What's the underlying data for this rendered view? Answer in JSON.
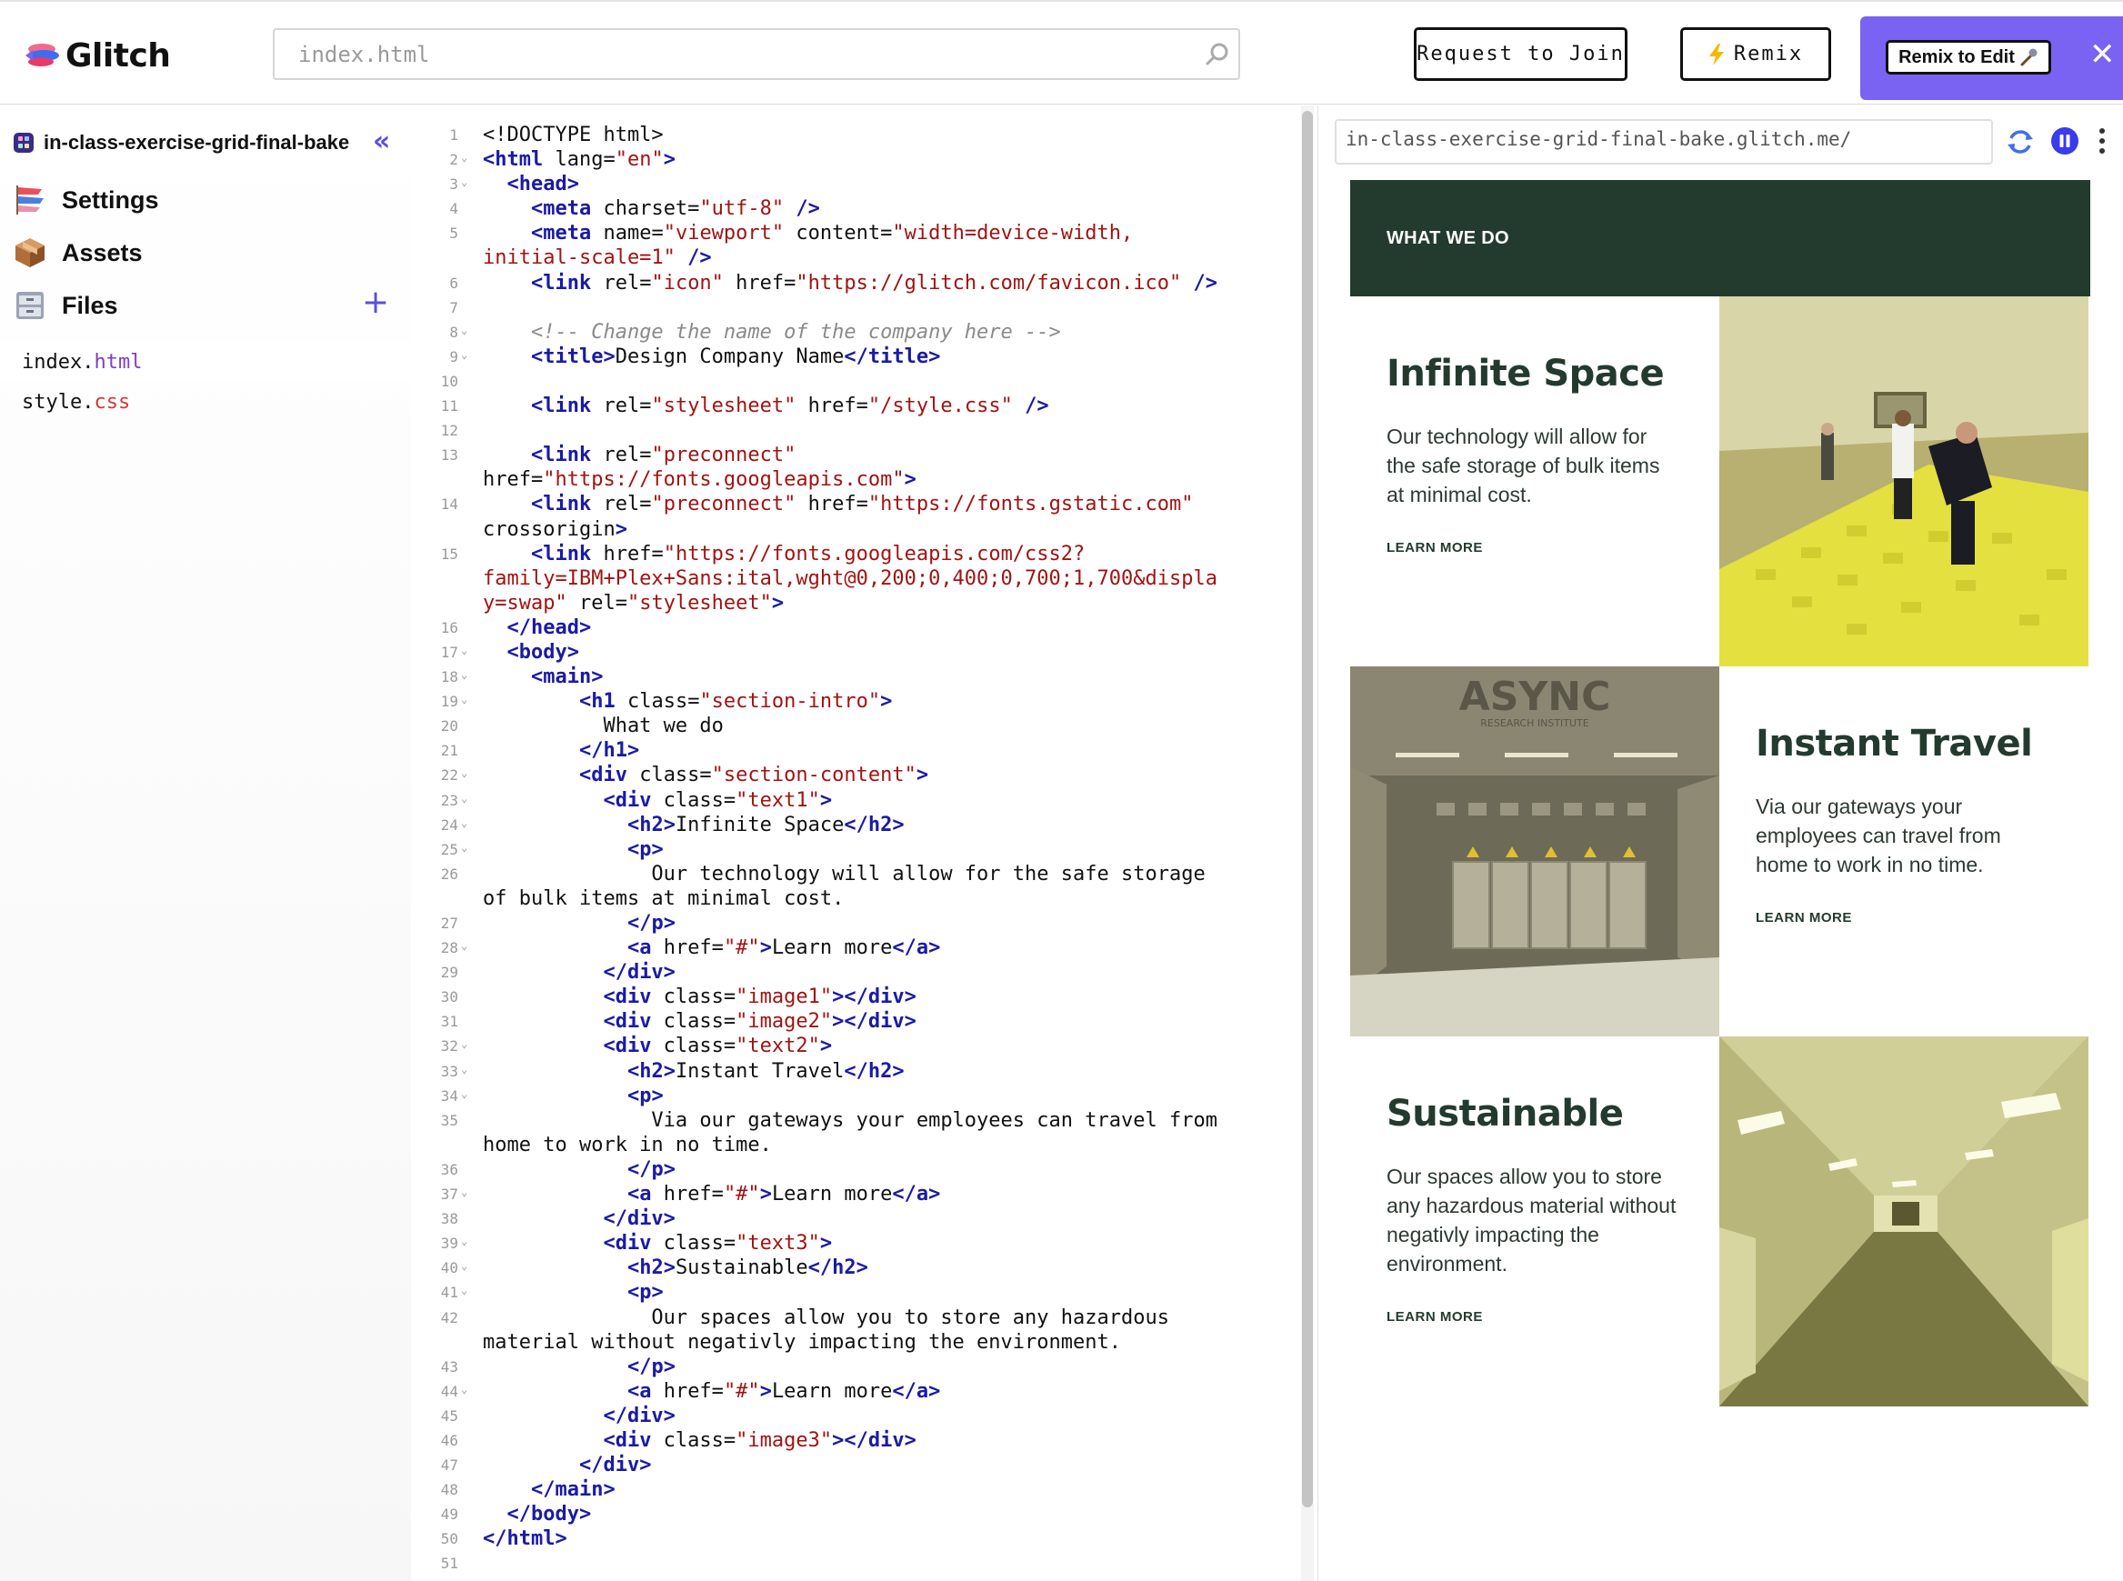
{
  "header": {
    "app_name": "Glitch",
    "search_placeholder": "index.html",
    "request_join_label": "Request to Join",
    "remix_label": "Remix",
    "remix_to_edit_label": "Remix to Edit",
    "close_symbol": "✕"
  },
  "sidebar": {
    "project_name": "in-class-exercise-grid-final-bake",
    "collapse_symbol": "«",
    "nav": [
      {
        "label": "Settings",
        "icon": "settings-carp-icon"
      },
      {
        "label": "Assets",
        "icon": "package-icon"
      },
      {
        "label": "Files",
        "icon": "file-cabinet-icon"
      }
    ],
    "add_symbol": "+",
    "files": [
      {
        "base": "index.",
        "ext": "html"
      },
      {
        "base": "style.",
        "ext": "css"
      }
    ]
  },
  "editor": {
    "lines": [
      [
        [
          "a",
          "<!DOCTYPE html>"
        ]
      ],
      [
        [
          "t",
          "<html"
        ],
        [
          "a",
          " lang="
        ],
        [
          "s",
          "\"en\""
        ],
        [
          "t",
          ">"
        ]
      ],
      [
        [
          "a",
          "  "
        ],
        [
          "t",
          "<head>"
        ]
      ],
      [
        [
          "a",
          "    "
        ],
        [
          "t",
          "<meta"
        ],
        [
          "a",
          " charset="
        ],
        [
          "s",
          "\"utf-8\""
        ],
        [
          "a",
          " "
        ],
        [
          "t",
          "/>"
        ]
      ],
      [
        [
          "a",
          "    "
        ],
        [
          "t",
          "<meta"
        ],
        [
          "a",
          " name="
        ],
        [
          "s",
          "\"viewport\""
        ],
        [
          "a",
          " content="
        ],
        [
          "s",
          "\"width=device-width,"
        ]
      ],
      [
        [
          "s",
          "initial-scale=1\""
        ],
        [
          "a",
          " "
        ],
        [
          "t",
          "/>"
        ]
      ],
      [
        [
          "a",
          "    "
        ],
        [
          "t",
          "<link"
        ],
        [
          "a",
          " rel="
        ],
        [
          "s",
          "\"icon\""
        ],
        [
          "a",
          " href="
        ],
        [
          "s",
          "\"https://glitch.com/favicon.ico\""
        ],
        [
          "a",
          " "
        ],
        [
          "t",
          "/>"
        ]
      ],
      [],
      [
        [
          "a",
          "    "
        ],
        [
          "c",
          "<!-- Change the name of the company here -->"
        ]
      ],
      [
        [
          "a",
          "    "
        ],
        [
          "t",
          "<title>"
        ],
        [
          "a",
          "Design Company Name"
        ],
        [
          "t",
          "</title>"
        ]
      ],
      [],
      [
        [
          "a",
          "    "
        ],
        [
          "t",
          "<link"
        ],
        [
          "a",
          " rel="
        ],
        [
          "s",
          "\"stylesheet\""
        ],
        [
          "a",
          " href="
        ],
        [
          "s",
          "\"/style.css\""
        ],
        [
          "a",
          " "
        ],
        [
          "t",
          "/>"
        ]
      ],
      [],
      [
        [
          "a",
          "    "
        ],
        [
          "t",
          "<link"
        ],
        [
          "a",
          " rel="
        ],
        [
          "s",
          "\"preconnect\""
        ]
      ],
      [
        [
          "a",
          "href="
        ],
        [
          "s",
          "\"https://fonts.googleapis.com\""
        ],
        [
          "t",
          ">"
        ]
      ],
      [
        [
          "a",
          "    "
        ],
        [
          "t",
          "<link"
        ],
        [
          "a",
          " rel="
        ],
        [
          "s",
          "\"preconnect\""
        ],
        [
          "a",
          " href="
        ],
        [
          "s",
          "\"https://fonts.gstatic.com\""
        ]
      ],
      [
        [
          "a",
          "crossorigin"
        ],
        [
          "t",
          ">"
        ]
      ],
      [
        [
          "a",
          "    "
        ],
        [
          "t",
          "<link"
        ],
        [
          "a",
          " href="
        ],
        [
          "s",
          "\"https://fonts.googleapis.com/css2?"
        ]
      ],
      [
        [
          "s",
          "family=IBM+Plex+Sans:ital,wght@0,200;0,400;0,700;1,700&displa"
        ]
      ],
      [
        [
          "s",
          "y=swap\""
        ],
        [
          "a",
          " rel="
        ],
        [
          "s",
          "\"stylesheet\""
        ],
        [
          "t",
          ">"
        ]
      ],
      [
        [
          "a",
          "  "
        ],
        [
          "t",
          "</head>"
        ]
      ],
      [
        [
          "a",
          "  "
        ],
        [
          "t",
          "<body>"
        ]
      ],
      [
        [
          "a",
          "    "
        ],
        [
          "t",
          "<main>"
        ]
      ],
      [
        [
          "a",
          "        "
        ],
        [
          "t",
          "<h1"
        ],
        [
          "a",
          " class="
        ],
        [
          "s",
          "\"section-intro\""
        ],
        [
          "t",
          ">"
        ]
      ],
      [
        [
          "a",
          "          What we do"
        ]
      ],
      [
        [
          "a",
          "        "
        ],
        [
          "t",
          "</h1>"
        ]
      ],
      [
        [
          "a",
          "        "
        ],
        [
          "t",
          "<div"
        ],
        [
          "a",
          " class="
        ],
        [
          "s",
          "\"section-content\""
        ],
        [
          "t",
          ">"
        ]
      ],
      [
        [
          "a",
          "          "
        ],
        [
          "t",
          "<div"
        ],
        [
          "a",
          " class="
        ],
        [
          "s",
          "\"text1\""
        ],
        [
          "t",
          ">"
        ]
      ],
      [
        [
          "a",
          "            "
        ],
        [
          "t",
          "<h2>"
        ],
        [
          "a",
          "Infinite Space"
        ],
        [
          "t",
          "</h2>"
        ]
      ],
      [
        [
          "a",
          "            "
        ],
        [
          "t",
          "<p>"
        ]
      ],
      [
        [
          "a",
          "              Our technology will allow for the safe storage"
        ]
      ],
      [
        [
          "a",
          "of bulk items at minimal cost."
        ]
      ],
      [
        [
          "a",
          "            "
        ],
        [
          "t",
          "</p>"
        ]
      ],
      [
        [
          "a",
          "            "
        ],
        [
          "t",
          "<a"
        ],
        [
          "a",
          " href="
        ],
        [
          "s",
          "\"#\""
        ],
        [
          "t",
          ">"
        ],
        [
          "a",
          "Learn more"
        ],
        [
          "t",
          "</a>"
        ]
      ],
      [
        [
          "a",
          "          "
        ],
        [
          "t",
          "</div>"
        ]
      ],
      [
        [
          "a",
          "          "
        ],
        [
          "t",
          "<div"
        ],
        [
          "a",
          " class="
        ],
        [
          "s",
          "\"image1\""
        ],
        [
          "t",
          "></div>"
        ]
      ],
      [
        [
          "a",
          "          "
        ],
        [
          "t",
          "<div"
        ],
        [
          "a",
          " class="
        ],
        [
          "s",
          "\"image2\""
        ],
        [
          "t",
          "></div>"
        ]
      ],
      [
        [
          "a",
          "          "
        ],
        [
          "t",
          "<div"
        ],
        [
          "a",
          " class="
        ],
        [
          "s",
          "\"text2\""
        ],
        [
          "t",
          ">"
        ]
      ],
      [
        [
          "a",
          "            "
        ],
        [
          "t",
          "<h2>"
        ],
        [
          "a",
          "Instant Travel"
        ],
        [
          "t",
          "</h2>"
        ]
      ],
      [
        [
          "a",
          "            "
        ],
        [
          "t",
          "<p>"
        ]
      ],
      [
        [
          "a",
          "              Via our gateways your employees can travel from"
        ]
      ],
      [
        [
          "a",
          "home to work in no time."
        ]
      ],
      [
        [
          "a",
          "            "
        ],
        [
          "t",
          "</p>"
        ]
      ],
      [
        [
          "a",
          "            "
        ],
        [
          "t",
          "<a"
        ],
        [
          "a",
          " href="
        ],
        [
          "s",
          "\"#\""
        ],
        [
          "t",
          ">"
        ],
        [
          "a",
          "Learn more"
        ],
        [
          "t",
          "</a>"
        ]
      ],
      [
        [
          "a",
          "          "
        ],
        [
          "t",
          "</div>"
        ]
      ],
      [
        [
          "a",
          "          "
        ],
        [
          "t",
          "<div"
        ],
        [
          "a",
          " class="
        ],
        [
          "s",
          "\"text3\""
        ],
        [
          "t",
          ">"
        ]
      ],
      [
        [
          "a",
          "            "
        ],
        [
          "t",
          "<h2>"
        ],
        [
          "a",
          "Sustainable"
        ],
        [
          "t",
          "</h2>"
        ]
      ],
      [
        [
          "a",
          "            "
        ],
        [
          "t",
          "<p>"
        ]
      ],
      [
        [
          "a",
          "              Our spaces allow you to store any hazardous"
        ]
      ],
      [
        [
          "a",
          "material without negativly impacting the environment."
        ]
      ],
      [
        [
          "a",
          "            "
        ],
        [
          "t",
          "</p>"
        ]
      ],
      [
        [
          "a",
          "            "
        ],
        [
          "t",
          "<a"
        ],
        [
          "a",
          " href="
        ],
        [
          "s",
          "\"#\""
        ],
        [
          "t",
          ">"
        ],
        [
          "a",
          "Learn more"
        ],
        [
          "t",
          "</a>"
        ]
      ],
      [
        [
          "a",
          "          "
        ],
        [
          "t",
          "</div>"
        ]
      ],
      [
        [
          "a",
          "          "
        ],
        [
          "t",
          "<div"
        ],
        [
          "a",
          " class="
        ],
        [
          "s",
          "\"image3\""
        ],
        [
          "t",
          "></div>"
        ]
      ],
      [
        [
          "a",
          "        "
        ],
        [
          "t",
          "</div>"
        ]
      ],
      [
        [
          "a",
          "    "
        ],
        [
          "t",
          "</main>"
        ]
      ],
      [
        [
          "a",
          "  "
        ],
        [
          "t",
          "</body>"
        ]
      ],
      [
        [
          "t",
          "</html>"
        ]
      ],
      []
    ],
    "line_numbers": [
      "1",
      "2",
      "3",
      "4",
      "5",
      "",
      "6",
      "7",
      "8",
      "9",
      "10",
      "11",
      "12",
      "13",
      "",
      "14",
      "",
      "15",
      "",
      "",
      "16",
      "17",
      "18",
      "19",
      "20",
      "21",
      "22",
      "23",
      "24",
      "25",
      "26",
      "",
      "27",
      "28",
      "29",
      "30",
      "31",
      "32",
      "33",
      "34",
      "35",
      "",
      "36",
      "37",
      "38",
      "39",
      "40",
      "41",
      "42",
      "",
      "43",
      "44",
      "45",
      "46",
      "47",
      "48",
      "49",
      "50",
      "51"
    ],
    "fold_lines": [
      "2",
      "3",
      "8",
      "9",
      "17",
      "18",
      "19",
      "22",
      "23",
      "24",
      "25",
      "28",
      "32",
      "33",
      "34",
      "37",
      "39",
      "40",
      "41",
      "44"
    ]
  },
  "preview": {
    "url": "in-class-exercise-grid-final-bake.glitch.me/",
    "intro": "WHAT WE DO",
    "sections": [
      {
        "title": "Infinite Space",
        "body": "Our technology will allow for the safe storage of bulk items at minimal cost.",
        "link": "LEARN MORE"
      },
      {
        "title": "Instant Travel",
        "body": "Via our gateways your employees can travel from home to work in no time.",
        "link": "LEARN MORE"
      },
      {
        "title": "Sustainable",
        "body": "Our spaces allow you to store any hazardous material without negativly impacting the environment.",
        "link": "LEARN MORE"
      }
    ],
    "image2_sign": "ASYNC",
    "image2_subsign": "RESEARCH INSTITUTE"
  },
  "colors": {
    "accent": "#7a62f2",
    "intro_bg": "#233b2e",
    "tag": "#1a1aa6",
    "string": "#a11313"
  }
}
